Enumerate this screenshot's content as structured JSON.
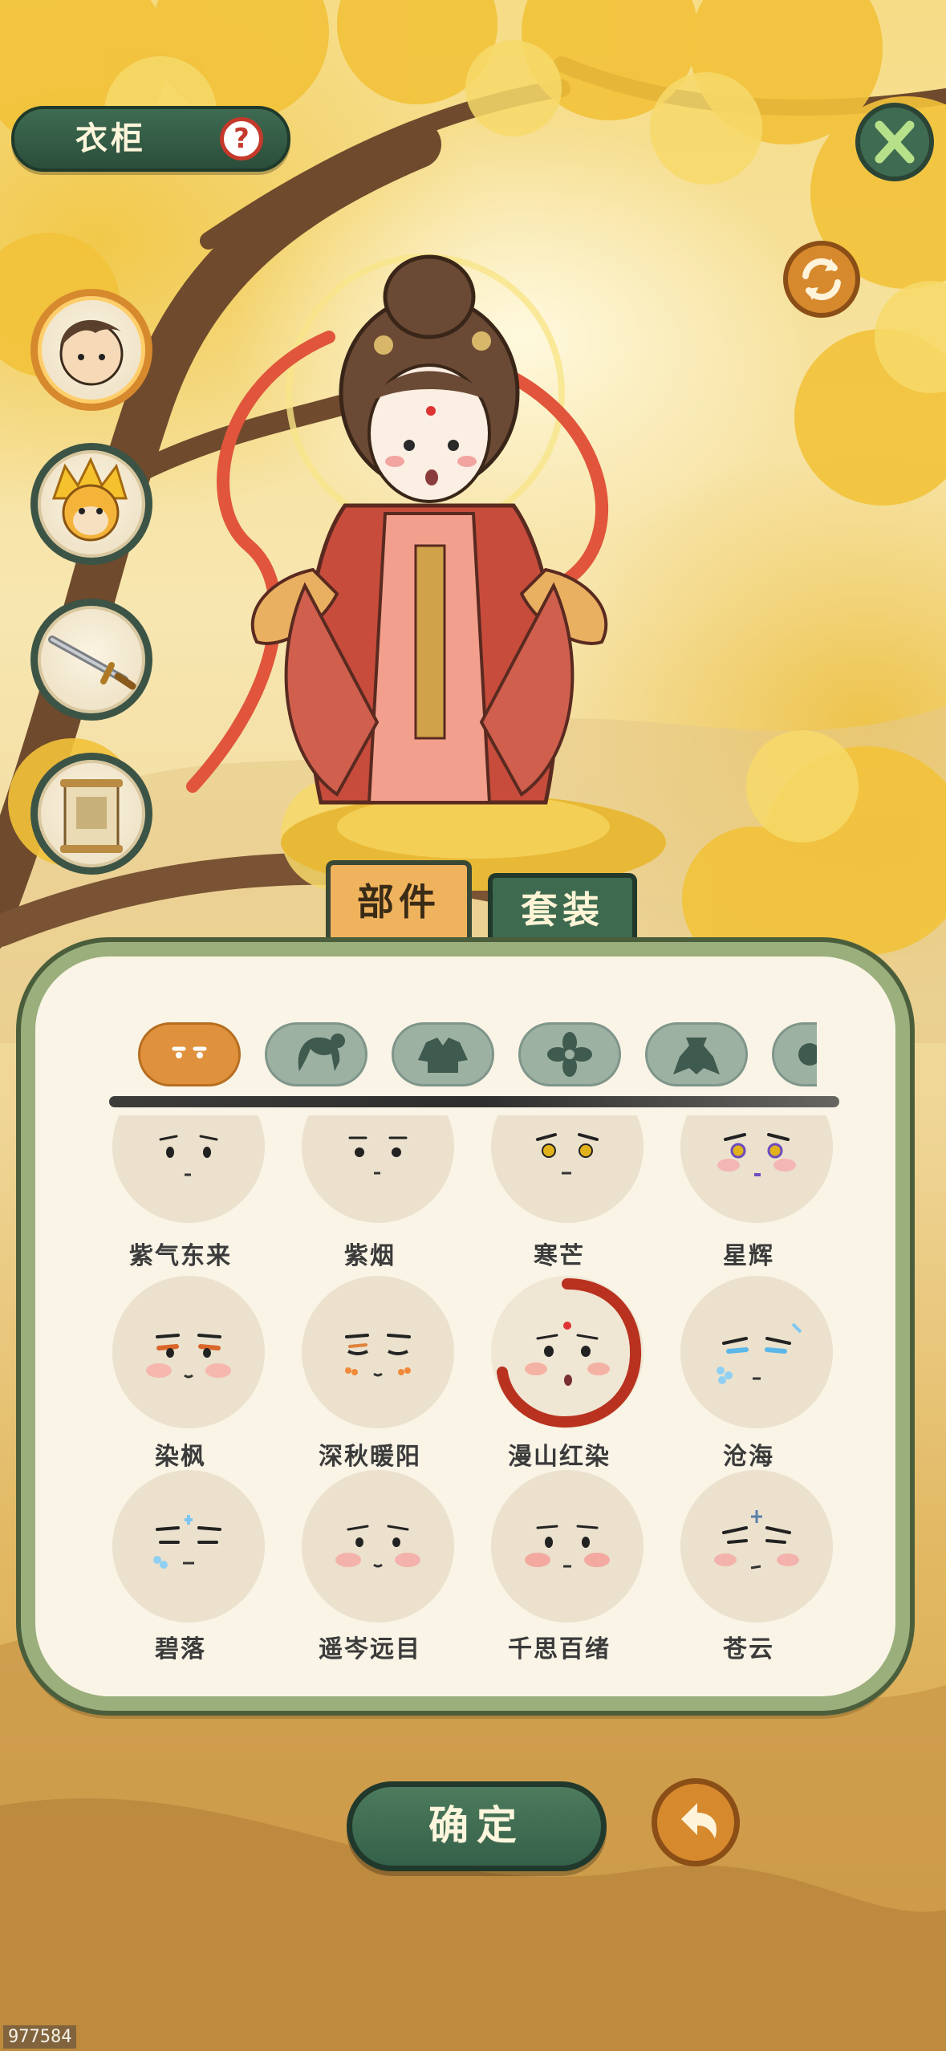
{
  "header": {
    "title": "衣柜",
    "help_glyph": "?"
  },
  "buttons": {
    "close_icon": "close-icon",
    "refresh_icon": "refresh-icon",
    "confirm_label": "确定",
    "undo_icon": "undo-icon"
  },
  "left_slots": [
    {
      "icon": "hero-portrait-icon",
      "active": true
    },
    {
      "icon": "monkey-king-portrait-icon",
      "active": false
    },
    {
      "icon": "sword-icon",
      "active": false
    },
    {
      "icon": "scroll-icon",
      "active": false
    }
  ],
  "tabs": [
    {
      "label": "部件",
      "active": true
    },
    {
      "label": "套装",
      "active": false
    }
  ],
  "categories": [
    {
      "icon": "face-icon",
      "active": true
    },
    {
      "icon": "hair-icon",
      "active": false
    },
    {
      "icon": "clothing-icon",
      "active": false
    },
    {
      "icon": "flower-accessory-icon",
      "active": false
    },
    {
      "icon": "mantle-icon",
      "active": false
    },
    {
      "icon": "more-icon",
      "active": false
    }
  ],
  "faces": [
    {
      "name": "紫气东来"
    },
    {
      "name": "紫烟"
    },
    {
      "name": "寒芒"
    },
    {
      "name": "星辉"
    },
    {
      "name": "染枫"
    },
    {
      "name": "深秋暖阳"
    },
    {
      "name": "漫山红染",
      "selected": true
    },
    {
      "name": "沧海"
    },
    {
      "name": "碧落"
    },
    {
      "name": "遥岑远目"
    },
    {
      "name": "千思百绪"
    },
    {
      "name": "苍云"
    }
  ],
  "watermark": "977584",
  "colors": {
    "accent_orange": "#d7892d",
    "dark_green": "#3e6a4f",
    "panel_green": "#9aaf7c",
    "selection_red": "#b8321f"
  }
}
